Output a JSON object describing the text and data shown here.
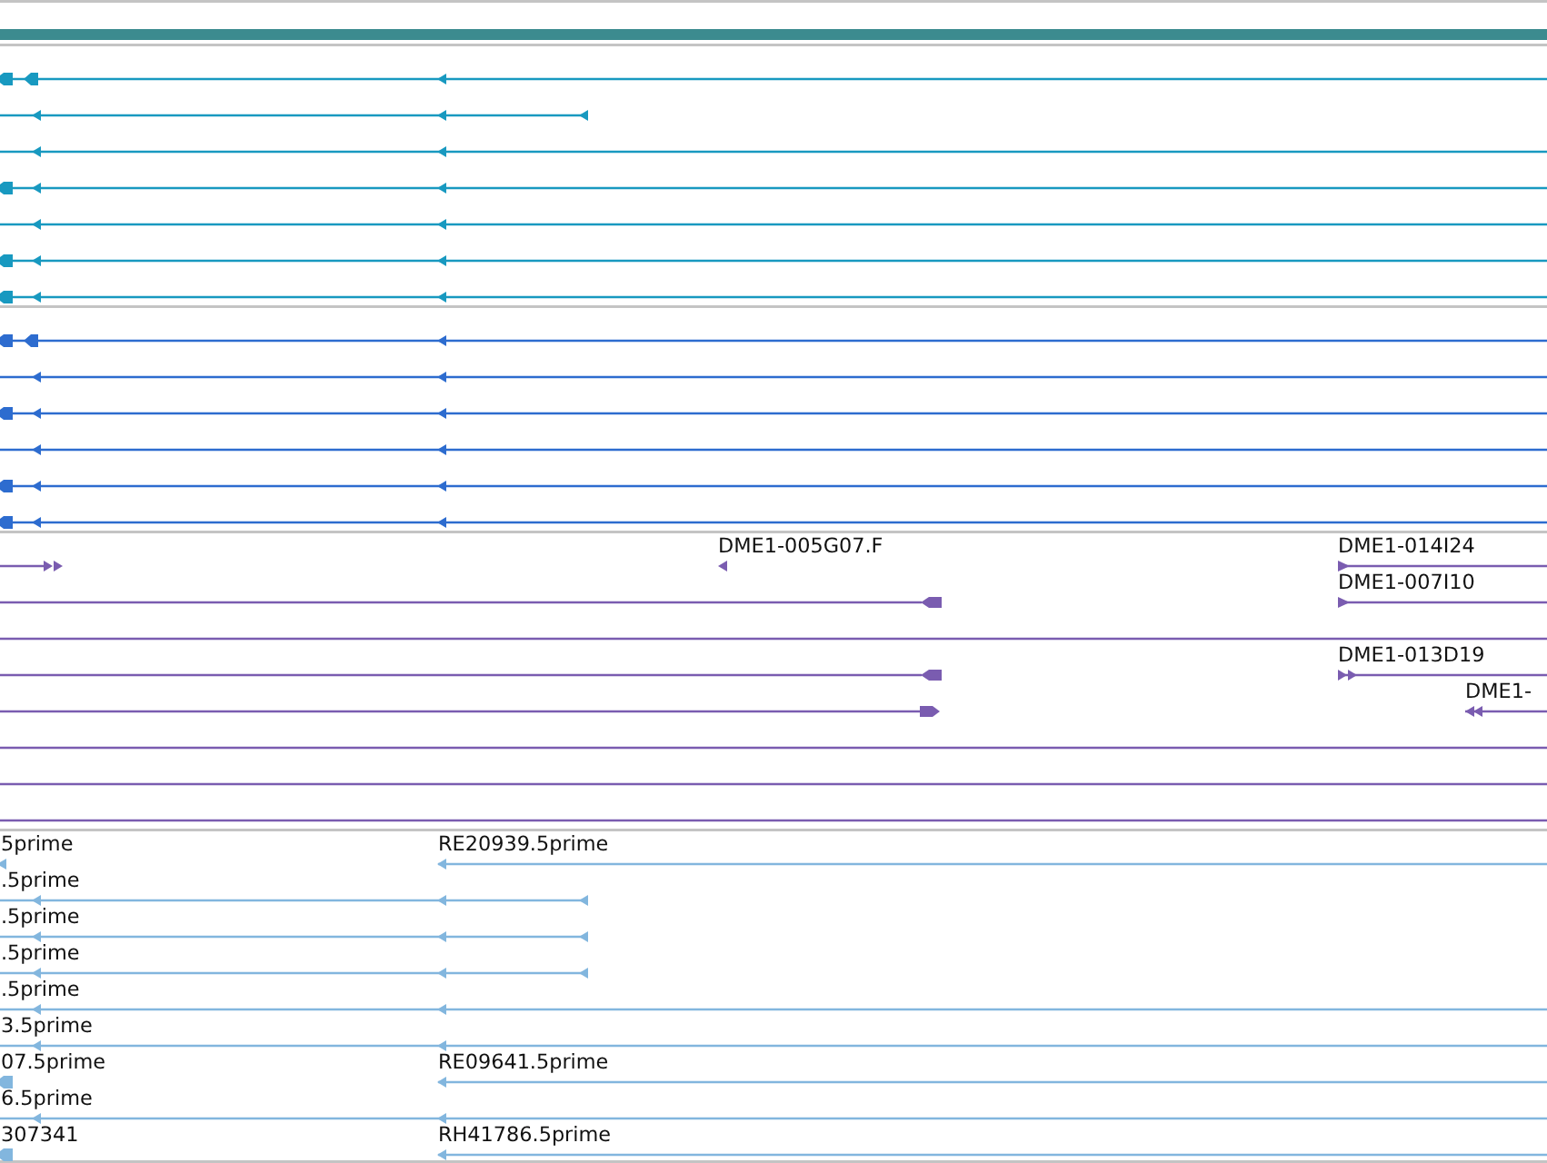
{
  "tracks": [
    {
      "color": "#1899c0"
    },
    {
      "color": "#2d6ccf"
    },
    {
      "color": "#7a5cb0",
      "labels": [
        "DME1-005G07.F",
        "DME1-014I24",
        "DME1-007I10",
        "DME1-013D19",
        "DME1-"
      ]
    },
    {
      "color": "#82b6de",
      "labels": [
        "5prime",
        "RE20939.5prime",
        ".5prime",
        ".5prime",
        ".5prime",
        ".5prime",
        "3.5prime",
        "07.5prime",
        "RE09641.5prime",
        "6.5prime",
        "307341",
        "RH41786.5prime"
      ]
    }
  ]
}
